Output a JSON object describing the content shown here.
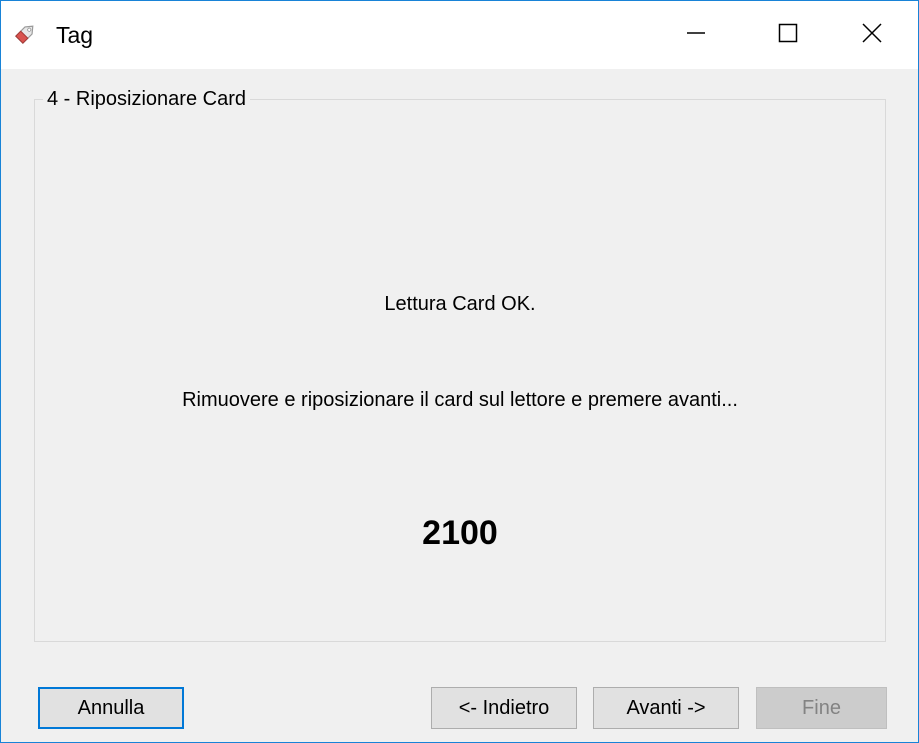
{
  "window": {
    "title": "Tag",
    "icon": "tag-icon",
    "controls": [
      "minimize-icon",
      "maximize-icon",
      "close-icon"
    ]
  },
  "step": {
    "title": "4 - Riposizionare Card",
    "status": "Lettura Card OK.",
    "instruction": "Rimuovere e riposizionare il card sul lettore e premere avanti...",
    "counter": "2100"
  },
  "buttons": {
    "cancel": "Annulla",
    "back": "<- Indietro",
    "next": "Avanti ->",
    "finish": "Fine"
  },
  "colors": {
    "accent": "#0078d7",
    "disabled_text": "#838383"
  }
}
